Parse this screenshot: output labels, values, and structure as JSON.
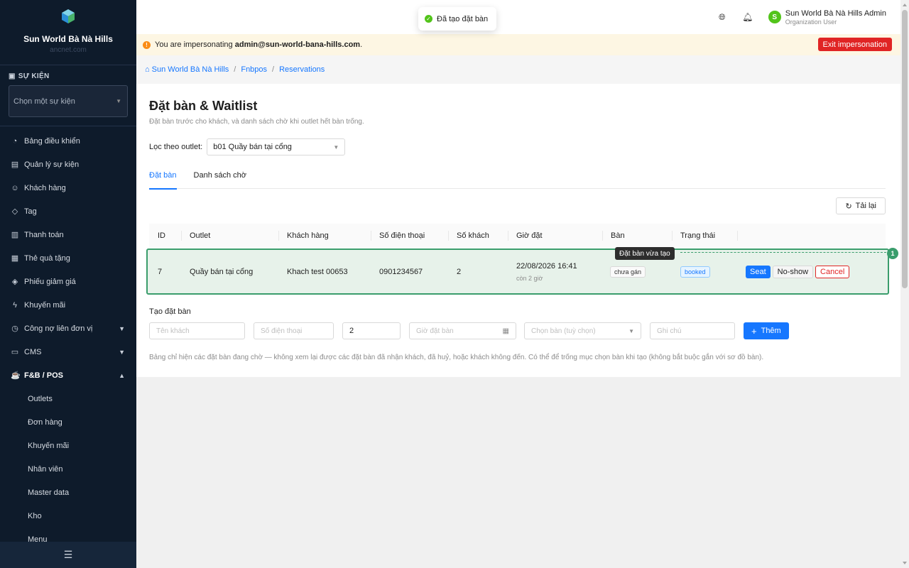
{
  "brand": {
    "name": "Sun World Bà Nà Hills",
    "sub": "ancnet.com"
  },
  "event": {
    "section_label": "SỰ KIỆN",
    "select_placeholder": "Chọn một sự kiện"
  },
  "menu": [
    {
      "label": "Bảng điều khiển",
      "icon": "dashboard-icon"
    },
    {
      "label": "Quản lý sự kiện",
      "icon": "calendar-icon"
    },
    {
      "label": "Khách hàng",
      "icon": "users-icon"
    },
    {
      "label": "Tag",
      "icon": "tag-icon"
    },
    {
      "label": "Thanh toán",
      "icon": "payment-icon"
    },
    {
      "label": "Thẻ quà tặng",
      "icon": "gift-icon"
    },
    {
      "label": "Phiếu giảm giá",
      "icon": "coupon-icon"
    },
    {
      "label": "Khuyến mãi",
      "icon": "promotion-icon"
    },
    {
      "label": "Công nợ liên đơn vị",
      "icon": "ledger-icon"
    },
    {
      "label": "CMS",
      "icon": "cms-icon"
    },
    {
      "label": "F&B / POS",
      "icon": "coffee-icon"
    }
  ],
  "submenu": [
    "Outlets",
    "Đơn hàng",
    "Khuyến mãi",
    "Nhân viên",
    "Master data",
    "Kho",
    "Menu"
  ],
  "header": {
    "user_name": "Sun World Bà Nà Hills Admin",
    "user_role": "Organization User",
    "avatar_letter": "S"
  },
  "toast": {
    "message": "Đã tạo đặt bàn"
  },
  "banner": {
    "prefix": "You are impersonating ",
    "email": "admin@sun-world-bana-hills.com",
    "suffix": ".",
    "exit_label": "Exit impersonation"
  },
  "breadcrumb": [
    "Sun World Bà Nà Hills",
    "Fnbpos",
    "Reservations"
  ],
  "page": {
    "title": "Đặt bàn & Waitlist",
    "subtitle": "Đặt bàn trước cho khách, và danh sách chờ khi outlet hết bàn trống.",
    "filter_label": "Lọc theo outlet:",
    "filter_value": "b01 Quầy bán tại cổng",
    "tabs": [
      "Đặt bàn",
      "Danh sách chờ"
    ],
    "reload_label": "Tải lại"
  },
  "table": {
    "columns": [
      "ID",
      "Outlet",
      "Khách hàng",
      "Số điện thoại",
      "Số khách",
      "Giờ đặt",
      "Bàn",
      "Trạng thái"
    ],
    "row": {
      "id": "7",
      "outlet": "Quầy bán tại cổng",
      "customer": "Khach test 00653",
      "phone": "0901234567",
      "guests": "2",
      "time": "22/08/2026 16:41",
      "time_note": "còn 2 giờ",
      "table": "chưa gán",
      "status": "booked",
      "actions": {
        "seat": "Seat",
        "noshow": "No-show",
        "cancel": "Cancel"
      }
    },
    "tooltip": "Đặt bàn vừa tạo",
    "badge": "1"
  },
  "create": {
    "title": "Tạo đặt bàn",
    "name_placeholder": "Tên khách",
    "phone_placeholder": "Số điện thoại",
    "guests_value": "2",
    "time_placeholder": "Giờ đặt bàn",
    "table_placeholder": "Chọn bàn (tuỳ chọn)",
    "note_placeholder": "Ghi chú",
    "add_label": "Thêm"
  },
  "help_text": "Bảng chỉ hiện các đặt bàn đang chờ — không xem lại được các đặt bàn đã nhận khách, đã huỷ, hoặc khách không đến. Có thể để trống mục chọn bàn khi tạo (không bắt buộc gắn với sơ đồ bàn).",
  "colors": {
    "sidebar": "#0e1b2b",
    "accent": "#1677ff",
    "danger": "#e02424",
    "success": "#3a9d6c"
  }
}
